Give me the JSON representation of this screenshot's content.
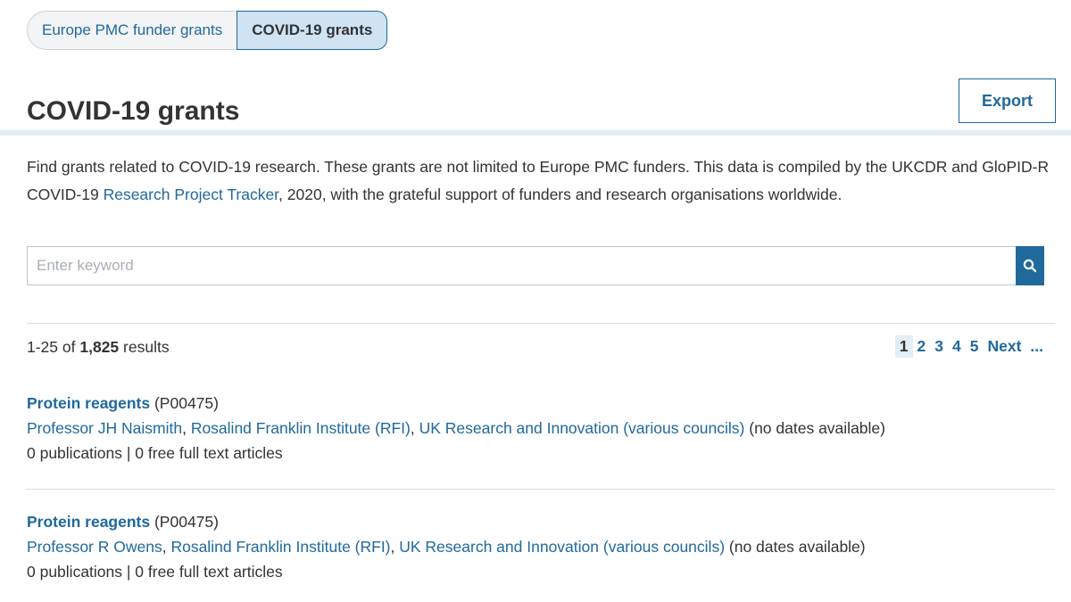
{
  "tabs": [
    {
      "label": "Europe PMC funder grants",
      "active": false
    },
    {
      "label": "COVID-19 grants",
      "active": true
    }
  ],
  "page_title": "COVID-19 grants",
  "export_label": "Export",
  "description": {
    "before_link": "Find grants related to COVID-19 research. These grants are not limited to Europe PMC funders. This data is compiled by the UKCDR and GloPID-R COVID-19 ",
    "link": "Research Project Tracker",
    "after_link": ", 2020, with the grateful support of funders and research organisations worldwide."
  },
  "search": {
    "placeholder": "Enter keyword",
    "value": ""
  },
  "results": {
    "range": "1-25 of",
    "total": "1,825",
    "suffix": "results"
  },
  "pagination": {
    "current": "1",
    "pages": [
      "2",
      "3",
      "4",
      "5"
    ],
    "next": "Next",
    "more": "..."
  },
  "grants": [
    {
      "title": "Protein reagents",
      "id": "(P00475)",
      "person": "Professor JH Naismith",
      "institution": "Rosalind Franklin Institute (RFI)",
      "funder": "UK Research and Innovation (various councils)",
      "dates": "(no dates available)",
      "stats": "0 publications | 0 free full text articles"
    },
    {
      "title": "Protein reagents",
      "id": "(P00475)",
      "person": "Professor R Owens",
      "institution": "Rosalind Franklin Institute (RFI)",
      "funder": "UK Research and Innovation (various councils)",
      "dates": "(no dates available)",
      "stats": "0 publications | 0 free full text articles"
    }
  ],
  "colors": {
    "link": "#20699c",
    "accent_bg": "#cfe3f3",
    "rule": "#e3eef6"
  }
}
